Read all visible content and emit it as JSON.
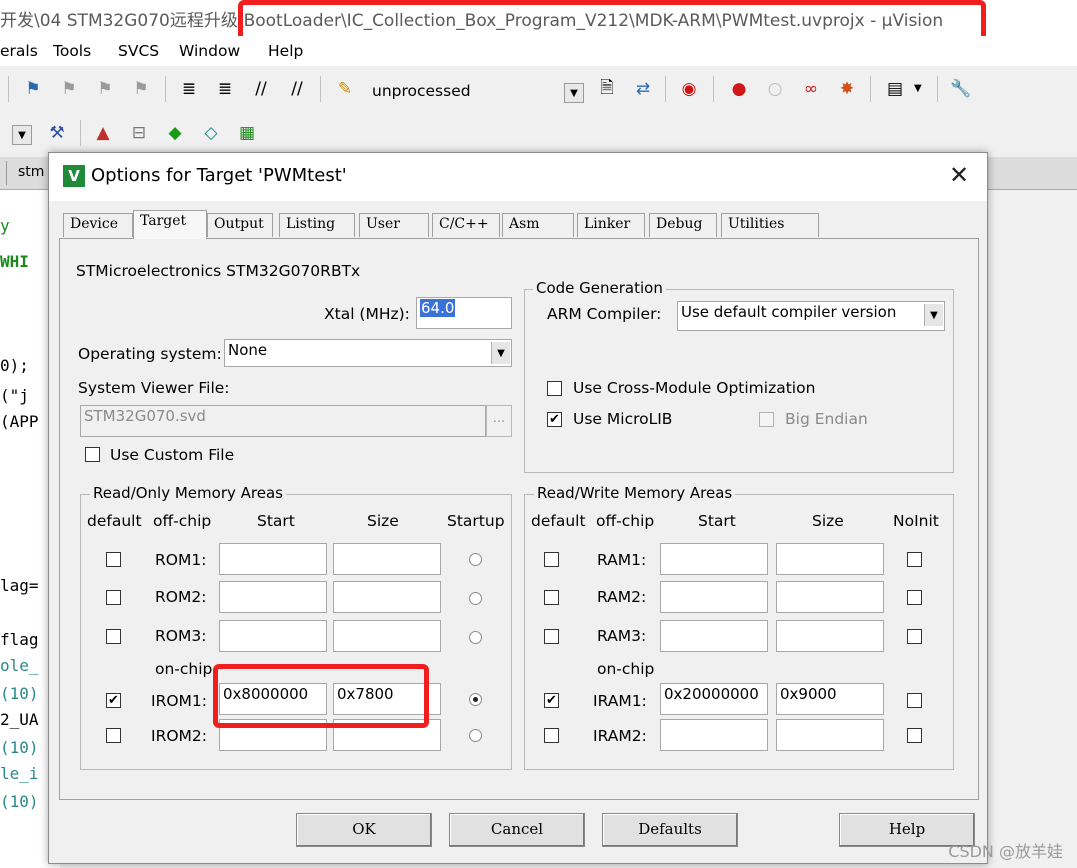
{
  "window": {
    "title_prefix": "开发\\04 STM32G070远程升级\\",
    "title_highlighted": "BootLoader\\IC_Collection_Box_Program_V212\\MDK-ARM\\PWMtest.uvprojx - µVision"
  },
  "menubar": [
    "erals",
    "Tools",
    "SVCS",
    "Window",
    "Help"
  ],
  "toolbar": {
    "target_name": "unprocessed"
  },
  "editor": {
    "tab_label": "stm",
    "code_lines": [
      "y",
      "WHI",
      "",
      "0);",
      "(\"j",
      "(APP",
      "",
      "",
      "",
      "",
      "lag=",
      "",
      "flag",
      "ole_",
      "(10)",
      "2_UA",
      "(10)",
      "le_i",
      "(10)"
    ]
  },
  "dialog": {
    "title": "Options for Target 'PWMtest'",
    "tabs": [
      "Device",
      "Target",
      "Output",
      "Listing",
      "User",
      "C/C++",
      "Asm",
      "Linker",
      "Debug",
      "Utilities"
    ],
    "active_tab": "Target",
    "device": "STMicroelectronics STM32G070RBTx",
    "xtal_label": "Xtal (MHz):",
    "xtal_value": "64.0",
    "os_label": "Operating system:",
    "os_value": "None",
    "sv_label": "System Viewer File:",
    "sv_value": "STM32G070.svd",
    "sv_browse": "...",
    "use_custom_file": "Use Custom File",
    "codegen": {
      "title": "Code Generation",
      "compiler_label": "ARM Compiler:",
      "compiler_value": "Use default compiler version",
      "cross_module": "Use Cross-Module Optimization",
      "microlib": "Use MicroLIB",
      "big_endian": "Big Endian"
    },
    "rom": {
      "title": "Read/Only Memory Areas",
      "headers": [
        "default",
        "off-chip",
        "Start",
        "Size",
        "Startup"
      ],
      "on_chip_label": "on-chip",
      "rows": [
        {
          "name": "ROM1:",
          "start": "",
          "size": "",
          "default": false,
          "startup": false
        },
        {
          "name": "ROM2:",
          "start": "",
          "size": "",
          "default": false,
          "startup": false
        },
        {
          "name": "ROM3:",
          "start": "",
          "size": "",
          "default": false,
          "startup": false
        },
        {
          "name": "IROM1:",
          "start": "0x8000000",
          "size": "0x7800",
          "default": true,
          "startup": true
        },
        {
          "name": "IROM2:",
          "start": "",
          "size": "",
          "default": false,
          "startup": false
        }
      ]
    },
    "ram": {
      "title": "Read/Write Memory Areas",
      "headers": [
        "default",
        "off-chip",
        "Start",
        "Size",
        "NoInit"
      ],
      "on_chip_label": "on-chip",
      "rows": [
        {
          "name": "RAM1:",
          "start": "",
          "size": "",
          "default": false,
          "noinit": false
        },
        {
          "name": "RAM2:",
          "start": "",
          "size": "",
          "default": false,
          "noinit": false
        },
        {
          "name": "RAM3:",
          "start": "",
          "size": "",
          "default": false,
          "noinit": false
        },
        {
          "name": "IRAM1:",
          "start": "0x20000000",
          "size": "0x9000",
          "default": true,
          "noinit": false
        },
        {
          "name": "IRAM2:",
          "start": "",
          "size": "",
          "default": false,
          "noinit": false
        }
      ]
    },
    "buttons": {
      "ok": "OK",
      "cancel": "Cancel",
      "defaults": "Defaults",
      "help": "Help"
    }
  },
  "watermark": "CSDN @放羊娃",
  "colors": {
    "highlight": "#f21d1d",
    "selection": "#3a72d8",
    "code_green": "#1a8a1a",
    "code_teal": "#2a8a8a"
  }
}
